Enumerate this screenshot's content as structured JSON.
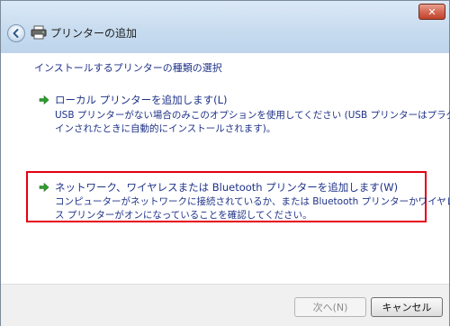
{
  "window": {
    "title": "プリンターの追加",
    "close_label": "✕"
  },
  "page": {
    "heading": "インストールするプリンターの種類の選択"
  },
  "options": [
    {
      "title": "ローカル プリンターを追加します(L)",
      "description_line1": "USB プリンターがない場合のみこのオプションを使用してください (USB プリンターはプラグ",
      "description_line2": "インされたときに自動的にインストールされます)。"
    },
    {
      "title": "ネットワーク、ワイヤレスまたは Bluetooth プリンターを追加します(W)",
      "description_line1": "コンピューターがネットワークに接続されているか、または Bluetooth プリンターかワイヤレ",
      "description_line2": "ス プリンターがオンになっていることを確認してください。"
    }
  ],
  "footer": {
    "next_label": "次へ(N)",
    "cancel_label": "キャンセル"
  },
  "colors": {
    "highlight_border": "#e60012",
    "link_text": "#1e3287",
    "arrow_green": "#2e9e2e"
  },
  "icons": {
    "back": "back-arrow-icon",
    "printer": "printer-icon",
    "option": "green-arrow-icon"
  }
}
